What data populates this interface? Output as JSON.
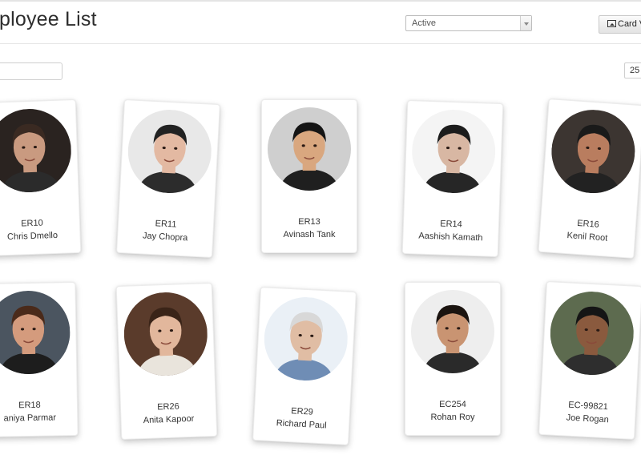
{
  "header": {
    "title": "mployee List",
    "status_filter": "Active",
    "view_button": "Card V"
  },
  "toolbar": {
    "search_value": "",
    "page_size": "25"
  },
  "employees": [
    {
      "code": "ER10",
      "name": "Chris Dmello",
      "skin": "#c99a80",
      "hair": "#3a2a22",
      "bg": "#2a2320",
      "shirt": "#2b2b2b"
    },
    {
      "code": "ER11",
      "name": "Jay Chopra",
      "skin": "#e3b9a2",
      "hair": "#222222",
      "bg": "#e8e8e8",
      "shirt": "#2c2c2c"
    },
    {
      "code": "ER13",
      "name": "Avinash Tank",
      "skin": "#d9a77f",
      "hair": "#151515",
      "bg": "#cfcfcf",
      "shirt": "#1f1f1f"
    },
    {
      "code": "ER14",
      "name": "Aashish Kamath",
      "skin": "#d8b7a3",
      "hair": "#1c1c1c",
      "bg": "#f4f4f4",
      "shirt": "#262626"
    },
    {
      "code": "ER16",
      "name": "Kenil Root",
      "skin": "#b97d5f",
      "hair": "#1a1a1a",
      "bg": "#3c3531",
      "shirt": "#222222"
    },
    {
      "code": "ER18",
      "name": "aniya Parmar",
      "skin": "#d49b7d",
      "hair": "#4a2a1a",
      "bg": "#4b5560",
      "shirt": "#1d1d1d"
    },
    {
      "code": "ER26",
      "name": "Anita Kapoor",
      "skin": "#e2b79c",
      "hair": "#3a2418",
      "bg": "#5a3b2b",
      "shirt": "#e9e4dc"
    },
    {
      "code": "ER29",
      "name": "Richard Paul",
      "skin": "#e0bda4",
      "hair": "#d8d8d8",
      "bg": "#eaf0f6",
      "shirt": "#6f8db5"
    },
    {
      "code": "EC254",
      "name": "Rohan Roy",
      "skin": "#c99472",
      "hair": "#1b1410",
      "bg": "#eeeeee",
      "shirt": "#2a2a2a"
    },
    {
      "code": "EC-99821",
      "name": "Joe Rogan",
      "skin": "#8a5a3e",
      "hair": "#151515",
      "bg": "#5d6b4f",
      "shirt": "#2e2e2e"
    }
  ]
}
